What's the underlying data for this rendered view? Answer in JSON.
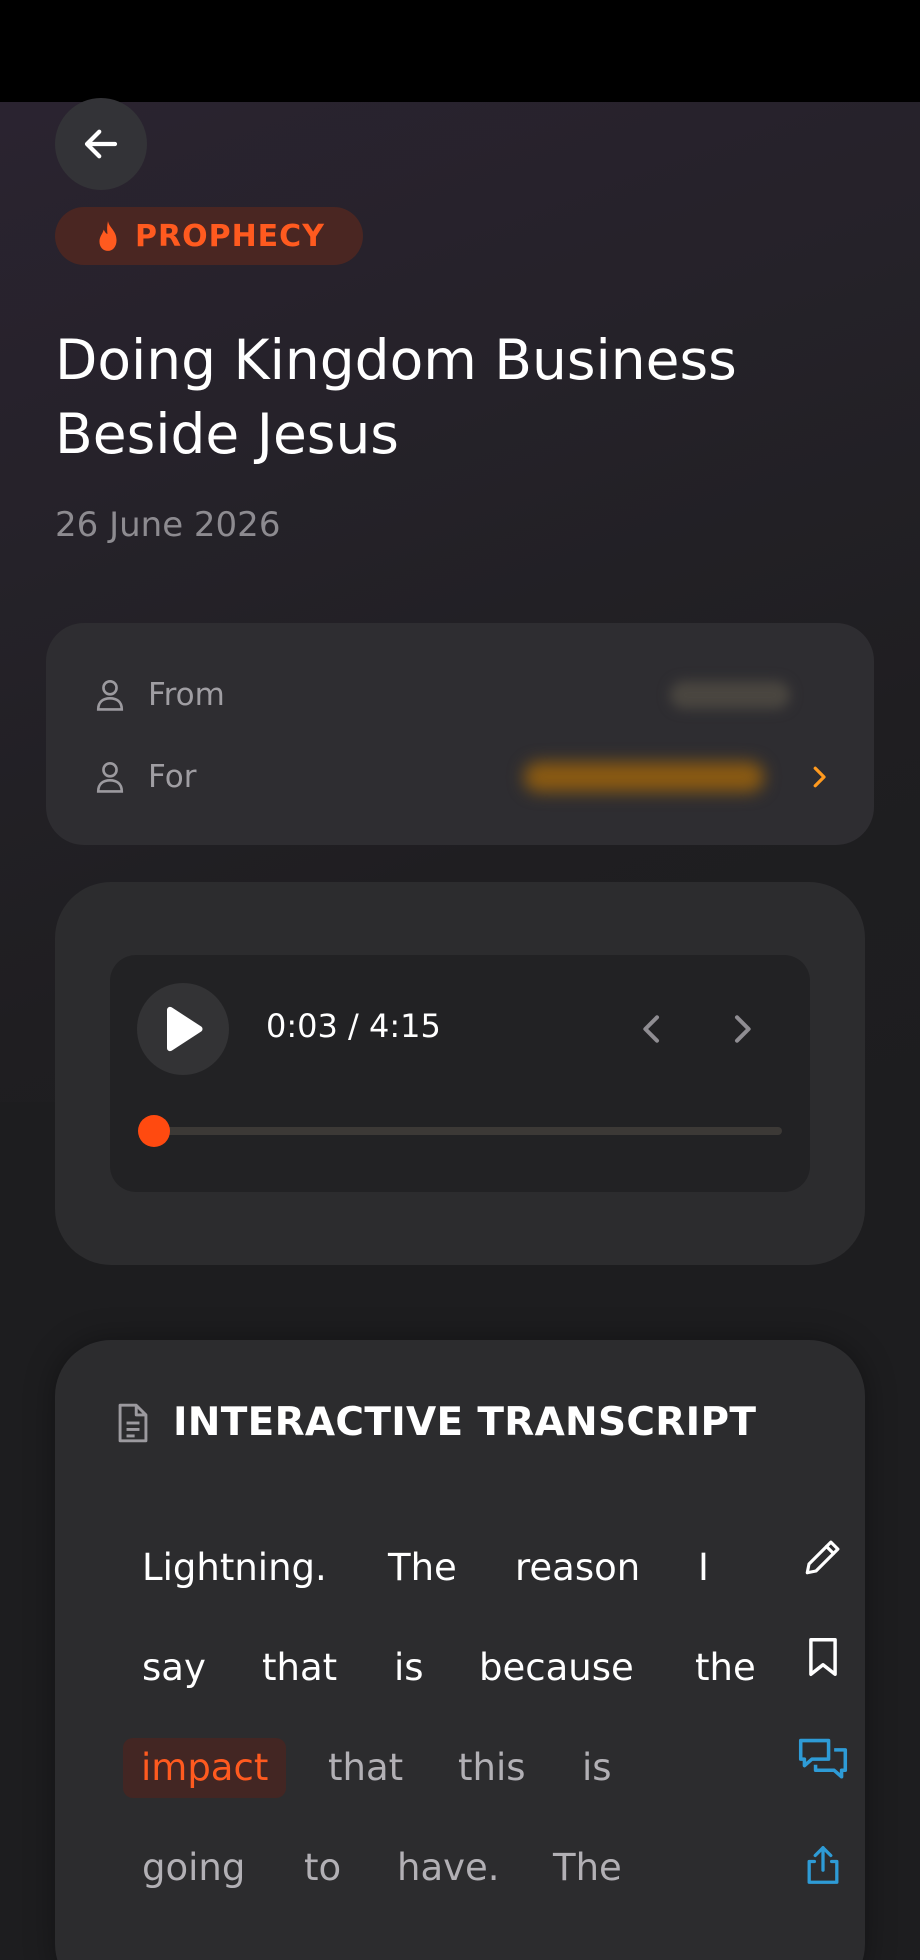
{
  "category": {
    "label": "PROPHECY",
    "color": "#ff5a1f"
  },
  "title": "Doing Kingdom Business Beside Jesus",
  "date": "26 June 2026",
  "meta": {
    "from_label": "From",
    "for_label": "For"
  },
  "player": {
    "time": "0:03 / 4:15",
    "progress_fraction": 0.012
  },
  "transcript": {
    "title": "INTERACTIVE TRANSCRIPT",
    "words": [
      {
        "text": "Lightning.",
        "state": "read"
      },
      {
        "text": "The",
        "state": "read"
      },
      {
        "text": "reason",
        "state": "read"
      },
      {
        "text": "I",
        "state": "read"
      },
      {
        "text": "say",
        "state": "read"
      },
      {
        "text": "that",
        "state": "read"
      },
      {
        "text": "is",
        "state": "read"
      },
      {
        "text": "because",
        "state": "read"
      },
      {
        "text": "the",
        "state": "read"
      },
      {
        "text": "impact",
        "state": "active"
      },
      {
        "text": "that",
        "state": "unread"
      },
      {
        "text": "this",
        "state": "unread"
      },
      {
        "text": "is",
        "state": "unread"
      },
      {
        "text": "going",
        "state": "unread"
      },
      {
        "text": "to",
        "state": "unread"
      },
      {
        "text": "have.",
        "state": "unread"
      },
      {
        "text": "The",
        "state": "unread"
      }
    ]
  },
  "colors": {
    "accent": "#ff4a10",
    "share_blue": "#2e9bd6"
  },
  "icons": {
    "back": "arrow-left-icon",
    "category": "flame-icon",
    "from": "person-icon",
    "for": "person-icon",
    "for_chevron": "chevron-right-icon",
    "play": "play-icon",
    "prev": "chevron-left-icon",
    "next": "chevron-right-icon",
    "transcript": "document-icon",
    "edit": "pencil-icon",
    "bookmark": "bookmark-icon",
    "comments": "chat-bubbles-icon",
    "share": "share-icon"
  }
}
